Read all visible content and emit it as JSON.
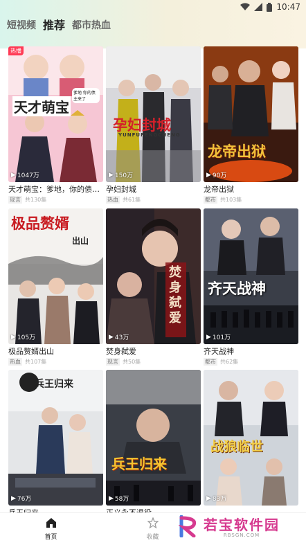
{
  "status_bar": {
    "time": "10:47"
  },
  "tabs": [
    {
      "label": "短视频",
      "active": false
    },
    {
      "label": "推荐",
      "active": true
    },
    {
      "label": "都市热血",
      "active": false
    }
  ],
  "cards": [
    {
      "title": "天才萌宝：爹地，你的债主...",
      "poster_text": "天才萌宝",
      "views": "1047万",
      "tag": "现言",
      "episodes": "共130集",
      "hot_badge": "热播",
      "poster_caption": "爹地 你的债主来了"
    },
    {
      "title": "孕妇封城",
      "poster_text": "孕妇封城",
      "poster_subtext": "YUNFUFENGCHENG",
      "views": "150万",
      "tag": "热血",
      "episodes": "共61集"
    },
    {
      "title": "龙帝出狱",
      "poster_text": "龙帝出狱",
      "views": "90万",
      "tag": "都市",
      "episodes": "共103集"
    },
    {
      "title": "极品赘婿出山",
      "poster_text": "极品赘婿",
      "poster_subtext": "出山",
      "views": "105万",
      "tag": "热血",
      "episodes": "共107集"
    },
    {
      "title": "焚身弑爱",
      "poster_text": "焚身弑爱",
      "views": "43万",
      "tag": "现言",
      "episodes": "共50集"
    },
    {
      "title": "齐天战神",
      "poster_text": "齐天战神",
      "views": "101万",
      "tag": "都市",
      "episodes": "共62集"
    },
    {
      "title": "兵王归来",
      "poster_text": "兵王归来",
      "views": "76万",
      "tag": "",
      "episodes": ""
    },
    {
      "title": "正义永不退役",
      "poster_text": "兵王归来",
      "views": "58万",
      "tag": "",
      "episodes": ""
    },
    {
      "title": "",
      "poster_text": "战狼临世",
      "views": "83万",
      "tag": "",
      "episodes": ""
    }
  ],
  "bottom_nav": [
    {
      "label": "首页",
      "icon": "home-icon",
      "active": true
    },
    {
      "label": "收藏",
      "icon": "star-icon",
      "active": false
    }
  ],
  "watermark": {
    "name": "若宝软件园",
    "url": "RBSGN.COM"
  },
  "colors": {
    "accent": "#222222",
    "badge": "#ff3a55",
    "watermark": "#d63a8f"
  }
}
